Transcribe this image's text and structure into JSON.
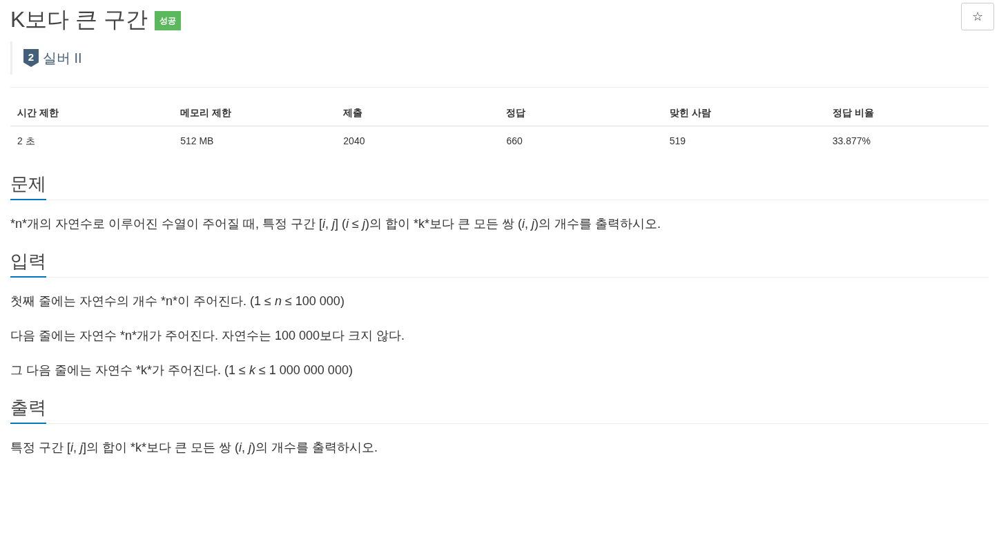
{
  "title": "K보다 큰 구간",
  "result_badge": "성공",
  "tier": {
    "number": "2",
    "label": "실버 II"
  },
  "star_button": "☆",
  "table": {
    "columns": [
      "시간 제한",
      "메모리 제한",
      "제출",
      "정답",
      "맞힌 사람",
      "정답 비율"
    ],
    "rows": [
      [
        "2 초",
        "512 MB",
        "2040",
        "660",
        "519",
        "33.877%"
      ]
    ]
  },
  "sections": [
    {
      "heading": "문제",
      "paragraphs": [
        "*n*개의 자연수로 이루어진 수열이 주어질 때, 특정 구간 [*i*, *j*] (*i* ≤ *j*)의 합이 *k*보다 큰 모든 쌍 (*i*, *j*)의 개수를 출력하시오."
      ]
    },
    {
      "heading": "입력",
      "paragraphs": [
        "첫째 줄에는 자연수의 개수 *n*이 주어진다. (1 ≤ *n* ≤ 100 000)",
        "다음 줄에는 자연수 *n*개가 주어진다. 자연수는 100 000보다 크지 않다.",
        "그 다음 줄에는 자연수 *k*가 주어진다. (1 ≤ *k* ≤ 1 000 000 000)"
      ]
    },
    {
      "heading": "출력",
      "paragraphs": [
        "특정 구간 [*i*, *j*]의 합이 *k*보다 큰 모든 쌍 (*i*, *j*)의 개수를 출력하시오."
      ]
    }
  ]
}
